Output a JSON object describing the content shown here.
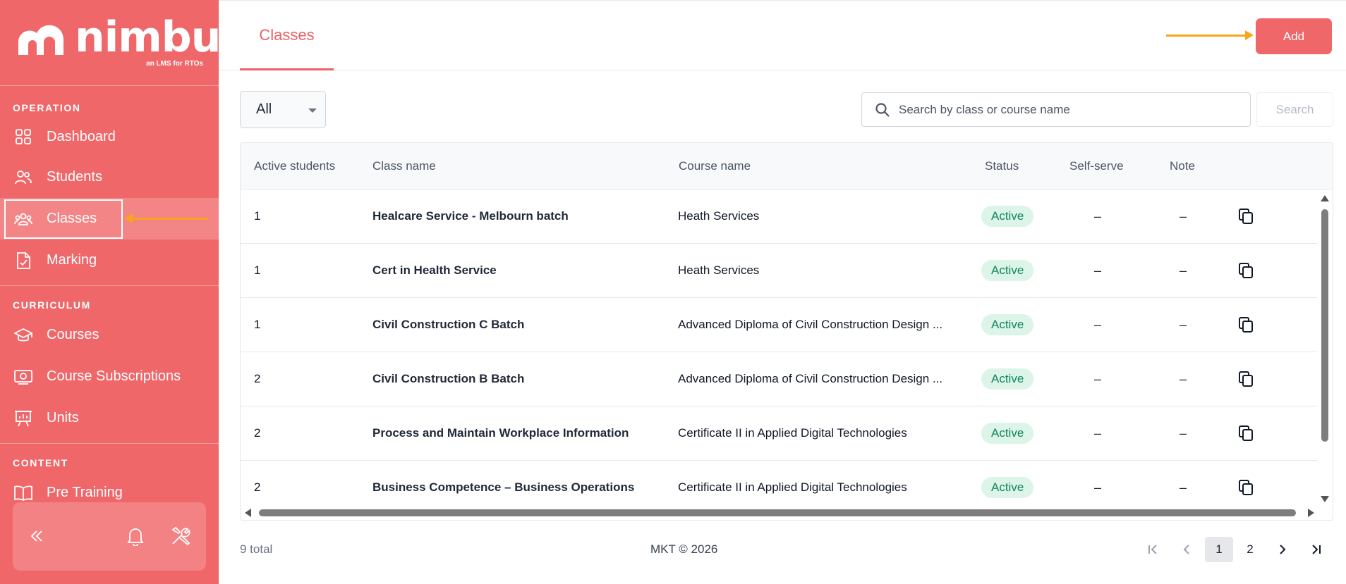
{
  "sidebar": {
    "brand": "nimbu",
    "tagline": "an LMS for RTOs",
    "sections": [
      {
        "label": "OPERATION"
      },
      {
        "label": "CURRICULUM"
      },
      {
        "label": "CONTENT"
      }
    ],
    "operation_items": [
      {
        "label": "Dashboard",
        "icon": "dashboard-icon"
      },
      {
        "label": "Students",
        "icon": "students-icon"
      },
      {
        "label": "Classes",
        "icon": "classes-icon",
        "active": true
      },
      {
        "label": "Marking",
        "icon": "marking-icon"
      }
    ],
    "curriculum_items": [
      {
        "label": "Courses",
        "icon": "courses-icon"
      },
      {
        "label": "Course Subscriptions",
        "icon": "course-subscriptions-icon"
      },
      {
        "label": "Units",
        "icon": "units-icon"
      }
    ],
    "content_items": [
      {
        "label": "Pre Training",
        "icon": "book-icon"
      }
    ],
    "footer_icons": [
      "collapse-icon",
      "bell-icon",
      "tools-icon"
    ]
  },
  "header": {
    "tab_label": "Classes",
    "add_label": "Add"
  },
  "filters": {
    "status_selected": "All",
    "search_placeholder": "Search by class or course name",
    "search_button": "Search"
  },
  "table": {
    "columns": [
      "Active students",
      "Class name",
      "Course name",
      "Status",
      "Self-serve",
      "Note"
    ],
    "rows": [
      {
        "active_students": "1",
        "class_name": "Healcare Service - Melbourn batch",
        "course_name": "Heath Services",
        "status": "Active",
        "self_serve": "–",
        "note": "–"
      },
      {
        "active_students": "1",
        "class_name": "Cert in Health Service",
        "course_name": "Heath Services",
        "status": "Active",
        "self_serve": "–",
        "note": "–"
      },
      {
        "active_students": "1",
        "class_name": "Civil Construction C Batch",
        "course_name": "Advanced Diploma of Civil Construction Design ...",
        "status": "Active",
        "self_serve": "–",
        "note": "–"
      },
      {
        "active_students": "2",
        "class_name": "Civil Construction B Batch",
        "course_name": "Advanced Diploma of Civil Construction Design ...",
        "status": "Active",
        "self_serve": "–",
        "note": "–"
      },
      {
        "active_students": "2",
        "class_name": "Process and Maintain Workplace Information",
        "course_name": "Certificate II in Applied Digital Technologies",
        "status": "Active",
        "self_serve": "–",
        "note": "–"
      },
      {
        "active_students": "2",
        "class_name": "Business Competence – Business Operations",
        "course_name": "Certificate II in Applied Digital Technologies",
        "status": "Active",
        "self_serve": "–",
        "note": "–"
      }
    ]
  },
  "footer": {
    "total": "9 total",
    "copyright": "MKT © 2026",
    "pages": [
      "1",
      "2"
    ],
    "current_page": "1"
  },
  "colors": {
    "brand": "#f0676a",
    "annotation_arrow": "#f8a51c",
    "status_active_bg": "#dcf5e8",
    "status_active_text": "#11875a"
  }
}
